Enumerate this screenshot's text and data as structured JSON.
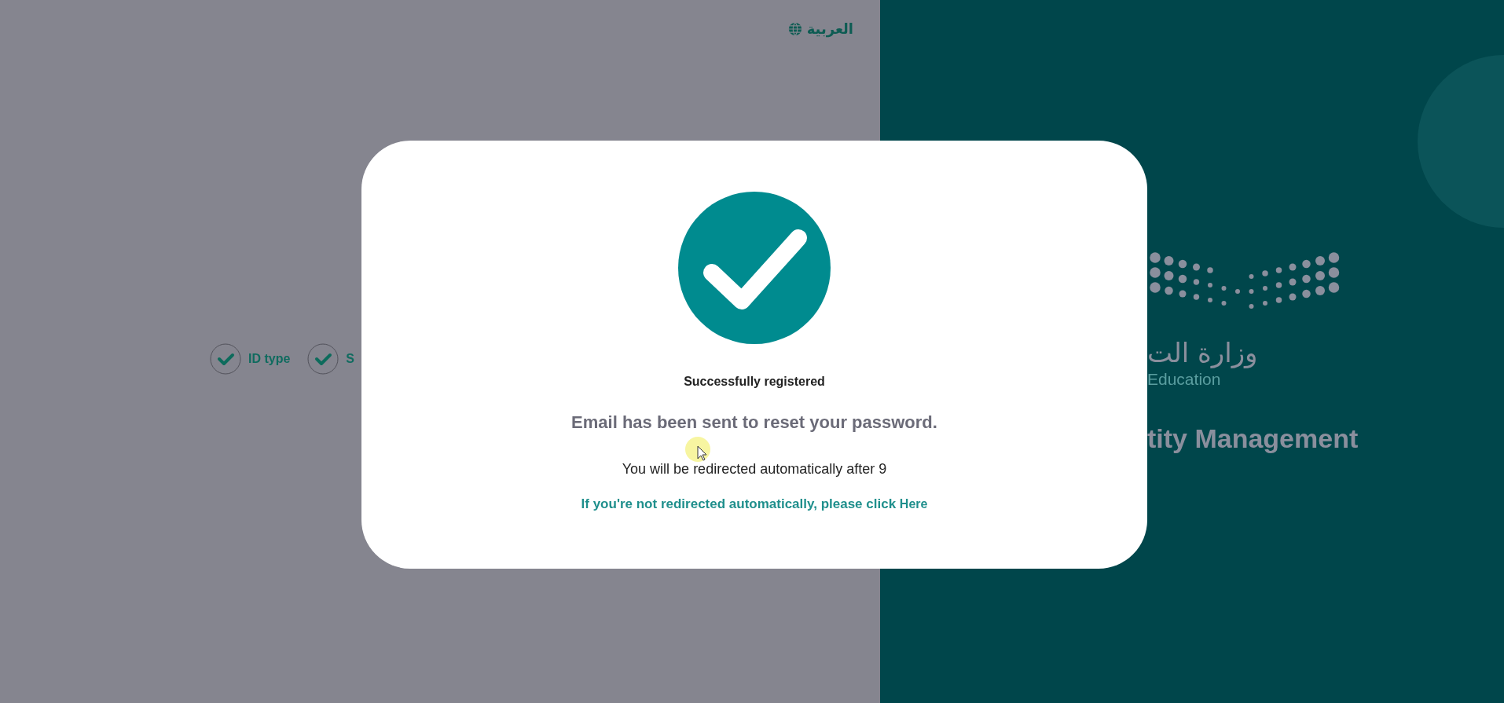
{
  "language_toggle": {
    "label": "العربية"
  },
  "steps": [
    {
      "label": "ID type",
      "done": true
    },
    {
      "label": "S",
      "done": true
    }
  ],
  "brand": {
    "arabic_name": "وزارة الت",
    "english_name": "Education",
    "app_title": "tity Management"
  },
  "dialog": {
    "title": "Successfully registered",
    "message": "Email has been sent to reset your password.",
    "countdown": "You will be redirected automatically after 9",
    "fallback_text": "If you're not redirected automatically, please click",
    "fallback_link": "Here"
  }
}
